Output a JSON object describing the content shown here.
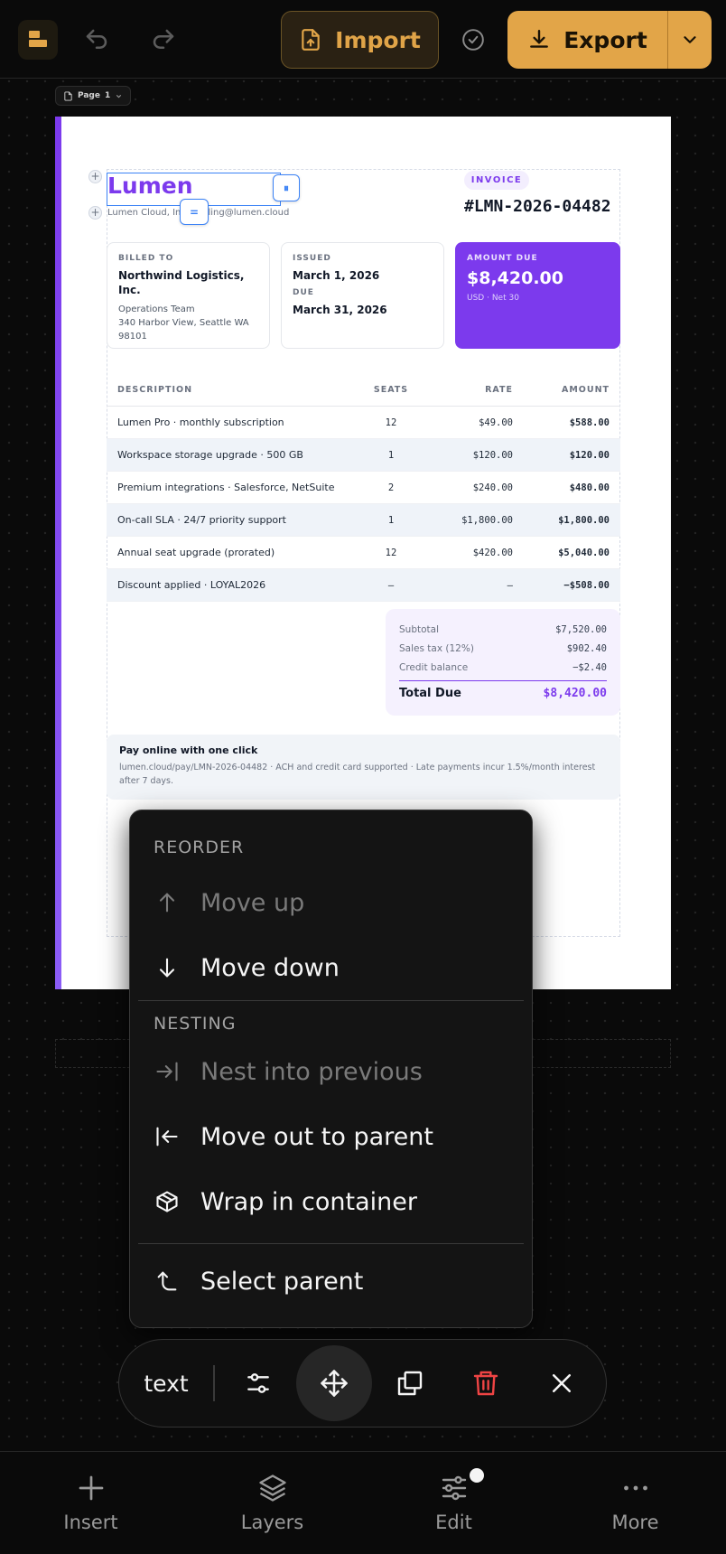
{
  "toolbar": {
    "import_label": "Import",
    "export_label": "Export"
  },
  "page_selector": {
    "label": "Page",
    "number": "1"
  },
  "invoice": {
    "brand": "Lumen",
    "brand_sub": "Lumen Cloud, Inc. · billing@lumen.cloud",
    "badge": "INVOICE",
    "number": "#LMN-2026-04482",
    "billed_to": {
      "label": "BILLED TO",
      "name": "Northwind Logistics, Inc.",
      "team": "Operations Team",
      "address": "340 Harbor View, Seattle WA 98101"
    },
    "dates": {
      "issued_label": "ISSUED",
      "issued": "March 1, 2026",
      "due_label": "DUE",
      "due": "March 31, 2026"
    },
    "amount_due": {
      "label": "AMOUNT DUE",
      "value": "$8,420.00",
      "sub": "USD · Net 30"
    },
    "table": {
      "headers": [
        "DESCRIPTION",
        "SEATS",
        "RATE",
        "AMOUNT"
      ],
      "rows": [
        [
          "Lumen Pro · monthly subscription",
          "12",
          "$49.00",
          "$588.00"
        ],
        [
          "Workspace storage upgrade · 500 GB",
          "1",
          "$120.00",
          "$120.00"
        ],
        [
          "Premium integrations · Salesforce, NetSuite",
          "2",
          "$240.00",
          "$480.00"
        ],
        [
          "On-call SLA · 24/7 priority support",
          "1",
          "$1,800.00",
          "$1,800.00"
        ],
        [
          "Annual seat upgrade (prorated)",
          "12",
          "$420.00",
          "$5,040.00"
        ],
        [
          "Discount applied · LOYAL2026",
          "–",
          "–",
          "−$508.00"
        ]
      ]
    },
    "totals": {
      "subtotal_label": "Subtotal",
      "subtotal": "$7,520.00",
      "tax_label": "Sales tax (12%)",
      "tax": "$902.40",
      "credit_label": "Credit balance",
      "credit": "−$2.40",
      "total_label": "Total Due",
      "total": "$8,420.00"
    },
    "pay": {
      "heading": "Pay online with one click",
      "text": "lumen.cloud/pay/LMN-2026-04482 · ACH and credit card supported · Late payments incur 1.5%/month interest after 7 days."
    }
  },
  "context_menu": {
    "reorder_heading": "REORDER",
    "move_up": "Move up",
    "move_down": "Move down",
    "nesting_heading": "NESTING",
    "nest_into_previous": "Nest into previous",
    "move_out": "Move out to parent",
    "wrap": "Wrap in container",
    "select_parent": "Select parent"
  },
  "floating_toolbar": {
    "element_type": "text"
  },
  "bottom_nav": {
    "insert": "Insert",
    "layers": "Layers",
    "edit": "Edit",
    "more": "More"
  },
  "colors": {
    "accent": "#e2a548",
    "brand_purple": "#7c3aed",
    "selection_blue": "#3b82f6",
    "danger": "#ef4444"
  },
  "icons": [
    "app-logo-icon",
    "undo-icon",
    "redo-icon",
    "upload-icon",
    "check-circle-icon",
    "download-icon",
    "chevron-down-icon",
    "page-icon",
    "arrow-up-icon",
    "arrow-down-icon",
    "indent-icon",
    "outdent-icon",
    "box-icon",
    "corner-up-icon",
    "sliders-icon",
    "move-icon",
    "duplicate-icon",
    "trash-icon",
    "close-icon",
    "plus-icon",
    "layers-icon",
    "more-icon"
  ]
}
